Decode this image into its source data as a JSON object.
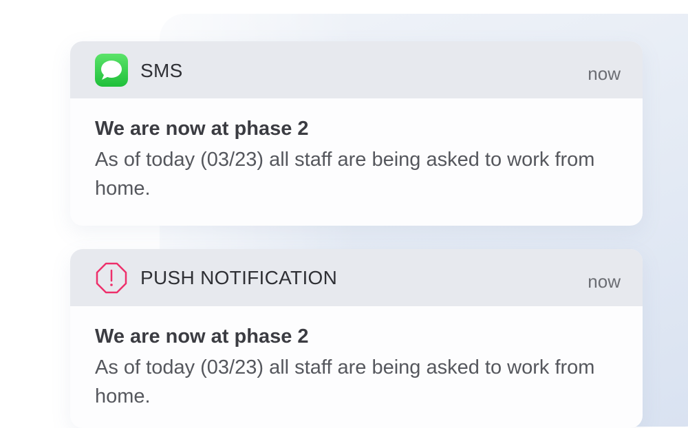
{
  "notifications": [
    {
      "app_name": "SMS",
      "time": "now",
      "title": "We are now at phase 2",
      "message": "As of today (03/23) all staff are being asked to work from home.",
      "icon": "message-bubble-icon",
      "icon_color": "#34c759"
    },
    {
      "app_name": "PUSH NOTIFICATION",
      "time": "now",
      "title": "We are now at phase 2",
      "message": "As of today (03/23) all staff are being asked to work from home.",
      "icon": "alert-octagon-icon",
      "icon_color": "#ee2f6a"
    }
  ],
  "colors": {
    "header_bg": "#e7e9ee",
    "card_bg": "#fdfdfe",
    "backdrop": "#dfe6f2"
  }
}
